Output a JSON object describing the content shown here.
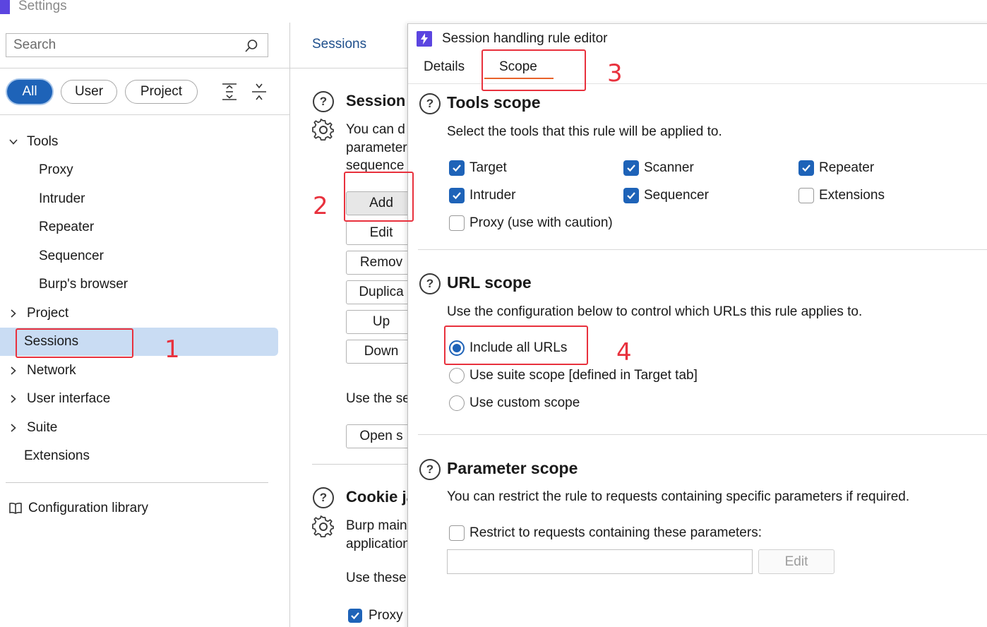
{
  "window": {
    "title": "Settings"
  },
  "search": {
    "placeholder": "Search"
  },
  "filters": {
    "all": "All",
    "user": "User",
    "project": "Project"
  },
  "nav": {
    "tools": "Tools",
    "tools_children": [
      "Proxy",
      "Intruder",
      "Repeater",
      "Sequencer",
      "Burp's browser"
    ],
    "project": "Project",
    "sessions": "Sessions",
    "network": "Network",
    "user_interface": "User interface",
    "suite": "Suite",
    "extensions": "Extensions",
    "config_library": "Configuration library"
  },
  "middle": {
    "breadcrumb": "Sessions",
    "section1_title": "Session l",
    "section1_desc": [
      "You can d",
      "parameter",
      "sequence"
    ],
    "buttons": [
      "Add",
      "Edit",
      "Remov",
      "Duplica",
      "Up",
      "Down"
    ],
    "use_text": "Use the se",
    "open_button": "Open s",
    "section2_title": "Cookie ja",
    "section2_desc": [
      "Burp main",
      "application"
    ],
    "use_these": "Use these",
    "proxy_check": "Proxy"
  },
  "dialog": {
    "title": "Session handling rule editor",
    "tabs": {
      "details": "Details",
      "scope": "Scope"
    },
    "tools_scope": {
      "title": "Tools scope",
      "desc": "Select the tools that this rule will be applied to.",
      "items": [
        {
          "label": "Target",
          "checked": true
        },
        {
          "label": "Scanner",
          "checked": true
        },
        {
          "label": "Repeater",
          "checked": true
        },
        {
          "label": "Intruder",
          "checked": true
        },
        {
          "label": "Sequencer",
          "checked": true
        },
        {
          "label": "Extensions",
          "checked": false
        },
        {
          "label": "Proxy (use with caution)",
          "checked": false
        }
      ]
    },
    "url_scope": {
      "title": "URL scope",
      "desc": "Use the configuration below to control which URLs this rule applies to.",
      "options": [
        {
          "label": "Include all URLs",
          "selected": true
        },
        {
          "label": "Use suite scope [defined in Target tab]",
          "selected": false
        },
        {
          "label": "Use custom scope",
          "selected": false
        }
      ]
    },
    "param_scope": {
      "title": "Parameter scope",
      "desc": "You can restrict the rule to requests containing specific parameters if required.",
      "restrict_label": "Restrict to requests containing these parameters:",
      "restrict_checked": false,
      "input_value": "",
      "edit_button": "Edit"
    }
  },
  "annotations": {
    "n1": "1",
    "n2": "2",
    "n3": "3",
    "n4": "4"
  },
  "colors": {
    "accent": "#1e63b8",
    "annotation": "#e8313d",
    "tab_underline": "#e8632b",
    "logo": "#5b45e0",
    "selection": "#c9dcf3"
  }
}
